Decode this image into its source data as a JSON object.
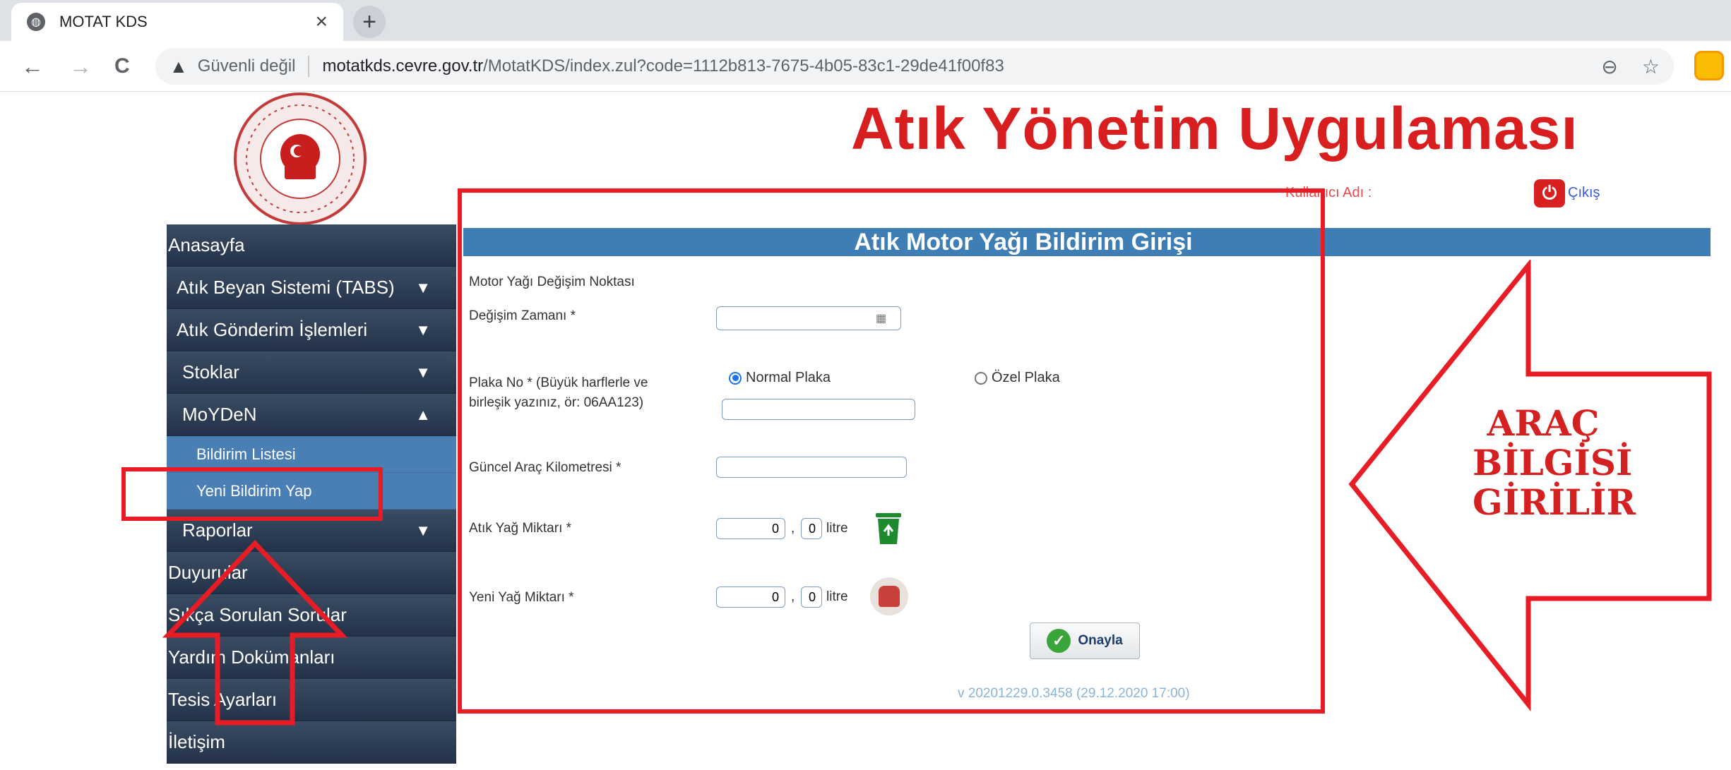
{
  "browser": {
    "tab_title": "MOTAT KDS",
    "tab_close": "×",
    "new_tab": "+",
    "back": "←",
    "forward": "→",
    "reload": "C",
    "security_warning": "Güvenli değil",
    "url_host": "motatkds.cevre.gov.tr",
    "url_path": "/MotatKDS/index.zul?code=1112b813-7675-4b05-83c1-29de41f00f83",
    "zoom_icon": "⊖",
    "bookmark_icon": "☆"
  },
  "header": {
    "app_title": "Atık Yönetim Uygulaması",
    "user_label": "Kullanıcı Adı :",
    "logout_label": "Çıkış"
  },
  "sidebar": {
    "items": [
      {
        "label": "Anasayfa"
      },
      {
        "label": "Atık Beyan Sistemi (TABS)",
        "chevron": "▼"
      },
      {
        "label": "Atık Gönderim İşlemleri",
        "chevron": "▼"
      },
      {
        "label": "Stoklar",
        "chevron": "▼"
      },
      {
        "label": "MoYDeN",
        "chevron": "▲"
      },
      {
        "label": "Raporlar",
        "chevron": "▼"
      },
      {
        "label": "Duyurular"
      },
      {
        "label": "Sıkça Sorulan Sorular"
      },
      {
        "label": "Yardım Dokümanları"
      },
      {
        "label": "Tesis Ayarları"
      },
      {
        "label": "İletişim"
      }
    ],
    "subitems": [
      {
        "label": "Bildirim Listesi"
      },
      {
        "label": "Yeni Bildirim Yap"
      }
    ]
  },
  "form": {
    "title": "Atık Motor Yağı Bildirim Girişi",
    "change_point_label": "Motor Yağı Değişim Noktası",
    "change_time_label": "Değişim Zamanı *",
    "change_time_value": "",
    "plate_label_line1": "Plaka No * (Büyük harflerle ve",
    "plate_label_line2": "birleşik yazınız, ör: 06AA123)",
    "plate_value": "",
    "plate_normal": "Normal Plaka",
    "plate_special": "Özel Plaka",
    "plate_normal_selected": true,
    "km_label": "Güncel Araç Kilometresi *",
    "km_value": "",
    "waste_oil_label": "Atık Yağ Miktarı *",
    "waste_oil_int": "0",
    "waste_oil_dec": "0",
    "new_oil_label": "Yeni Yağ Miktarı *",
    "new_oil_int": "0",
    "new_oil_dec": "0",
    "decimal_sep": ",",
    "unit": "litre",
    "confirm_button": "Onayla",
    "version": "v 20201229.0.3458 (29.12.2020 17:00)"
  },
  "annotation": {
    "line1": "ARAÇ",
    "line2": "BİLGİSİ",
    "line3": "GİRİLİR",
    "color": "#e81c24"
  }
}
